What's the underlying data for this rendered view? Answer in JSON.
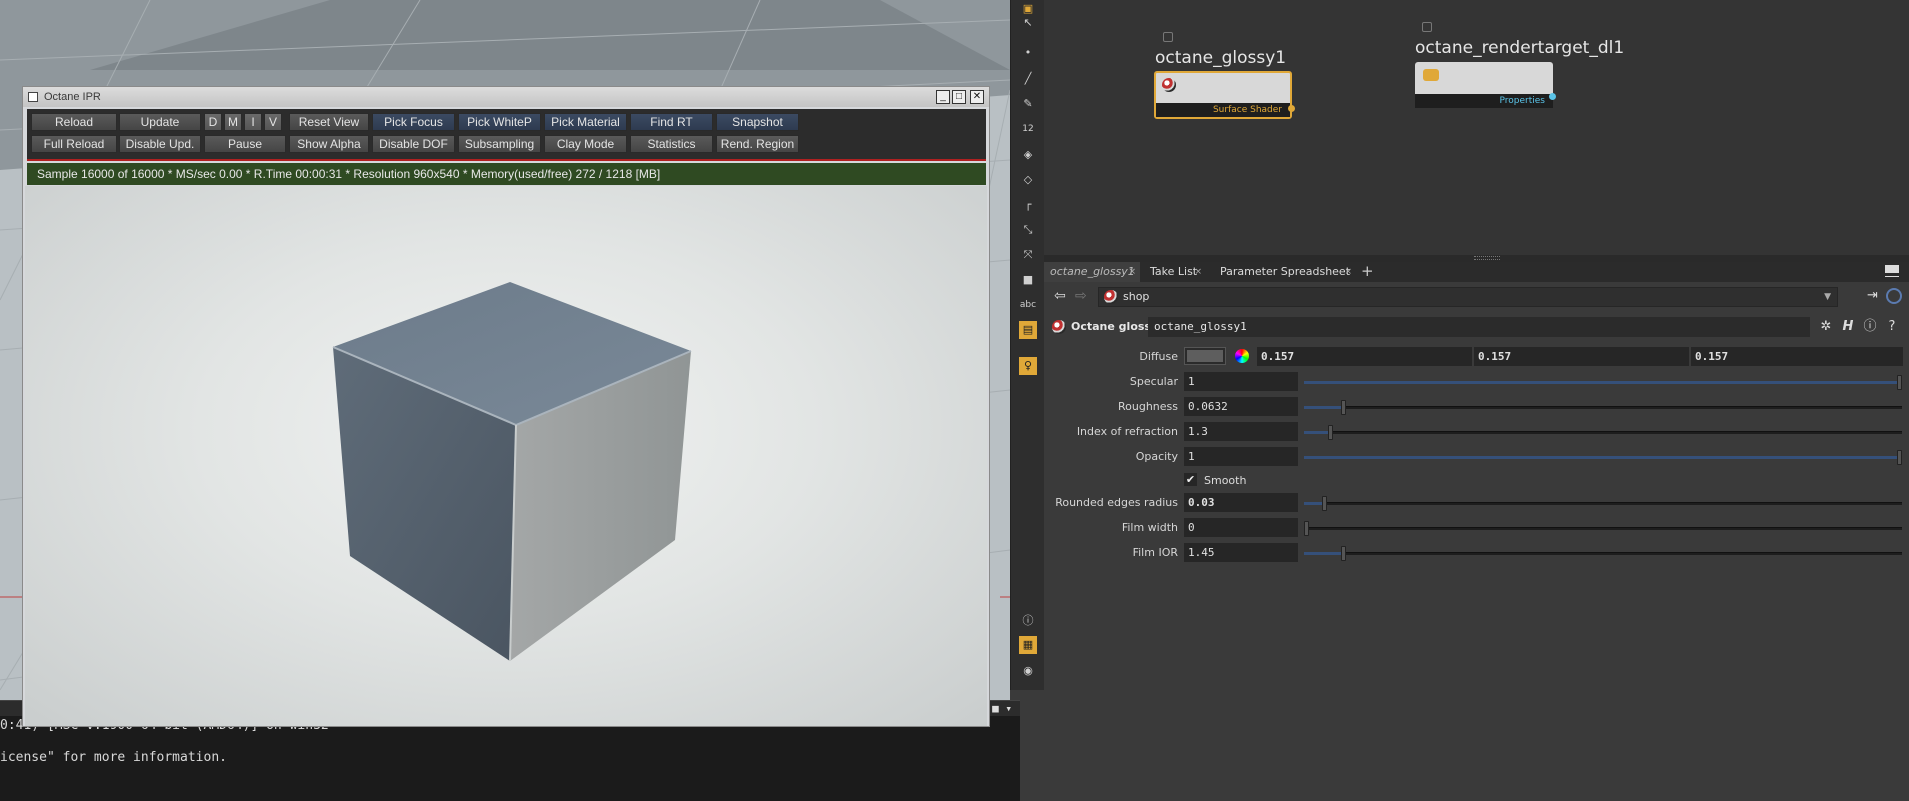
{
  "ipr": {
    "title": "Octane IPR",
    "buttons_row1": [
      "Reload",
      "Update",
      "D",
      "M",
      "I",
      "V",
      "Reset View",
      "Pick Focus",
      "Pick WhiteP",
      "Pick Material",
      "Find RT",
      "Snapshot"
    ],
    "buttons_row2": [
      "Full Reload",
      "Disable Upd.",
      "Pause",
      "Show Alpha",
      "Disable DOF",
      "Subsampling",
      "Clay Mode",
      "Statistics",
      "Rend. Region"
    ],
    "status": "Sample 16000 of 16000 * MS/sec 0.00 * R.Time 00:00:31 * Resolution 960x540 * Memory(used/free) 272 / 1218 [MB]",
    "minimize": "_",
    "maximize": "□",
    "close": "✕"
  },
  "console": {
    "line1": "0:41) [MSC v.1900 64 bit (AMD64)] on win32",
    "line2": "icense\" for more information."
  },
  "network": {
    "nodes": [
      {
        "name": "octane_glossy1",
        "port_label": "Surface Shader"
      },
      {
        "name": "octane_rendertarget_dl1",
        "port_label": "Properties"
      }
    ]
  },
  "tabs": [
    {
      "label": "octane_glossy1",
      "close": "×"
    },
    {
      "label": "Take List",
      "close": "×"
    },
    {
      "label": "Parameter Spreadsheet",
      "close": "×"
    }
  ],
  "tab_add": "+",
  "path": {
    "value": "shop"
  },
  "node_header": {
    "type": "Octane glossy",
    "name": "octane_glossy1"
  },
  "params": {
    "diffuse": {
      "label": "Diffuse",
      "r": "0.157",
      "g": "0.157",
      "b": "0.157"
    },
    "specular": {
      "label": "Specular",
      "value": "1",
      "level": 1.0
    },
    "roughness": {
      "label": "Roughness",
      "value": "0.0632",
      "level": 0.063
    },
    "ior": {
      "label": "Index of refraction",
      "value": "1.3",
      "level": 0.04
    },
    "opacity": {
      "label": "Opacity",
      "value": "1",
      "level": 1.0
    },
    "smooth": {
      "label": "Smooth",
      "checked": true
    },
    "rounded": {
      "label": "Rounded edges radius",
      "value": "0.03",
      "level": 0.03
    },
    "film_width": {
      "label": "Film width",
      "value": "0",
      "level": 0.0
    },
    "film_ior": {
      "label": "Film IOR",
      "value": "1.45",
      "level": 0.063
    }
  },
  "tools": [
    "arrow-icon",
    "brush-icon",
    "dot-icon",
    "pen-icon",
    "pencil-icon",
    "12-icon",
    "bucket-icon",
    "bucket2-icon",
    "corner-icon",
    "scale-icon",
    "move-icon",
    "stop-icon",
    "abc-icon",
    "image-icon",
    "lightbulb-icon",
    "info-icon",
    "grid-icon",
    "eye-icon"
  ],
  "tool_text_abc": "abc",
  "tool_text_12": "12",
  "colors": {
    "accent_orange": "#e0a838",
    "status_green": "#2f4a22",
    "port_blue": "#5bc4e8",
    "slider_blue": "#35507a"
  }
}
